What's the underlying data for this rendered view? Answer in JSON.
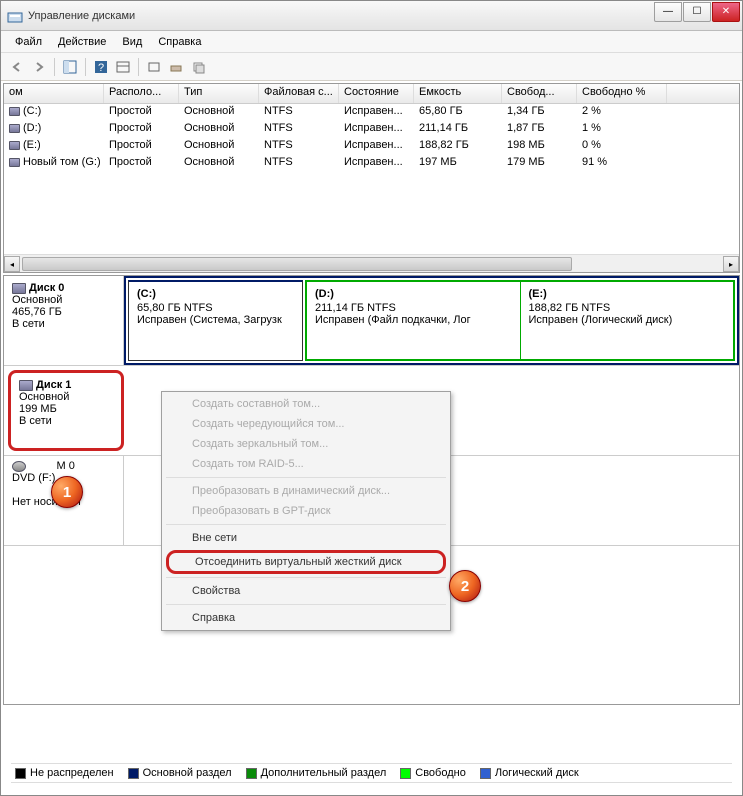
{
  "window": {
    "title": "Управление дисками"
  },
  "menus": [
    "Файл",
    "Действие",
    "Вид",
    "Справка"
  ],
  "table": {
    "columns": [
      "ом",
      "Располо...",
      "Тип",
      "Файловая с...",
      "Состояние",
      "Емкость",
      "Свобод...",
      "Свободно %"
    ],
    "rows": [
      {
        "name": "(C:)",
        "layout": "Простой",
        "type": "Основной",
        "fs": "NTFS",
        "status": "Исправен...",
        "capacity": "65,80 ГБ",
        "free": "1,34 ГБ",
        "freepct": "2 %"
      },
      {
        "name": "(D:)",
        "layout": "Простой",
        "type": "Основной",
        "fs": "NTFS",
        "status": "Исправен...",
        "capacity": "211,14 ГБ",
        "free": "1,87 ГБ",
        "freepct": "1 %"
      },
      {
        "name": "(E:)",
        "layout": "Простой",
        "type": "Основной",
        "fs": "NTFS",
        "status": "Исправен...",
        "capacity": "188,82 ГБ",
        "free": "198 МБ",
        "freepct": "0 %"
      },
      {
        "name": "Новый том (G:)",
        "layout": "Простой",
        "type": "Основной",
        "fs": "NTFS",
        "status": "Исправен...",
        "capacity": "197 МБ",
        "free": "179 МБ",
        "freepct": "91 %"
      }
    ]
  },
  "disks": {
    "disk0": {
      "name": "Диск 0",
      "type": "Основной",
      "size": "465,76 ГБ",
      "status": "В сети",
      "vols": {
        "c": {
          "label": "(C:)",
          "line2": "65,80 ГБ NTFS",
          "line3": "Исправен (Система, Загрузк"
        },
        "d": {
          "label": "(D:)",
          "line2": "211,14 ГБ NTFS",
          "line3": "Исправен (Файл подкачки, Лог"
        },
        "e": {
          "label": "(E:)",
          "line2": "188,82 ГБ NTFS",
          "line3": "Исправен (Логический диск)"
        }
      }
    },
    "disk1": {
      "name": "Диск 1",
      "type": "Основной",
      "size": "199 МБ",
      "status": "В сети"
    },
    "dvd": {
      "name": "M 0",
      "drive": "DVD (F:)",
      "status": "Нет носителя"
    }
  },
  "contextmenu": {
    "items": [
      {
        "label": "Создать составной том...",
        "disabled": true
      },
      {
        "label": "Создать чередующийся том...",
        "disabled": true
      },
      {
        "label": "Создать зеркальный том...",
        "disabled": true
      },
      {
        "label": "Создать том RAID-5...",
        "disabled": true
      },
      {
        "sep": true
      },
      {
        "label": "Преобразовать в динамический диск...",
        "disabled": true
      },
      {
        "label": "Преобразовать в GPT-диск",
        "disabled": true
      },
      {
        "sep": true
      },
      {
        "label": "Вне сети",
        "disabled": false
      },
      {
        "label": "Отсоединить виртуальный жесткий диск",
        "disabled": false,
        "highlighted": true
      },
      {
        "sep": true
      },
      {
        "label": "Свойства",
        "disabled": false
      },
      {
        "sep": true
      },
      {
        "label": "Справка",
        "disabled": false
      }
    ]
  },
  "legend": [
    {
      "color": "#000",
      "label": "Не распределен"
    },
    {
      "color": "#001a66",
      "label": "Основной раздел"
    },
    {
      "color": "#0a8a0a",
      "label": "Дополнительный раздел"
    },
    {
      "color": "#0f0",
      "label": "Свободно"
    },
    {
      "color": "#3060d0",
      "label": "Логический диск"
    }
  ],
  "callouts": {
    "one": "1",
    "two": "2"
  }
}
